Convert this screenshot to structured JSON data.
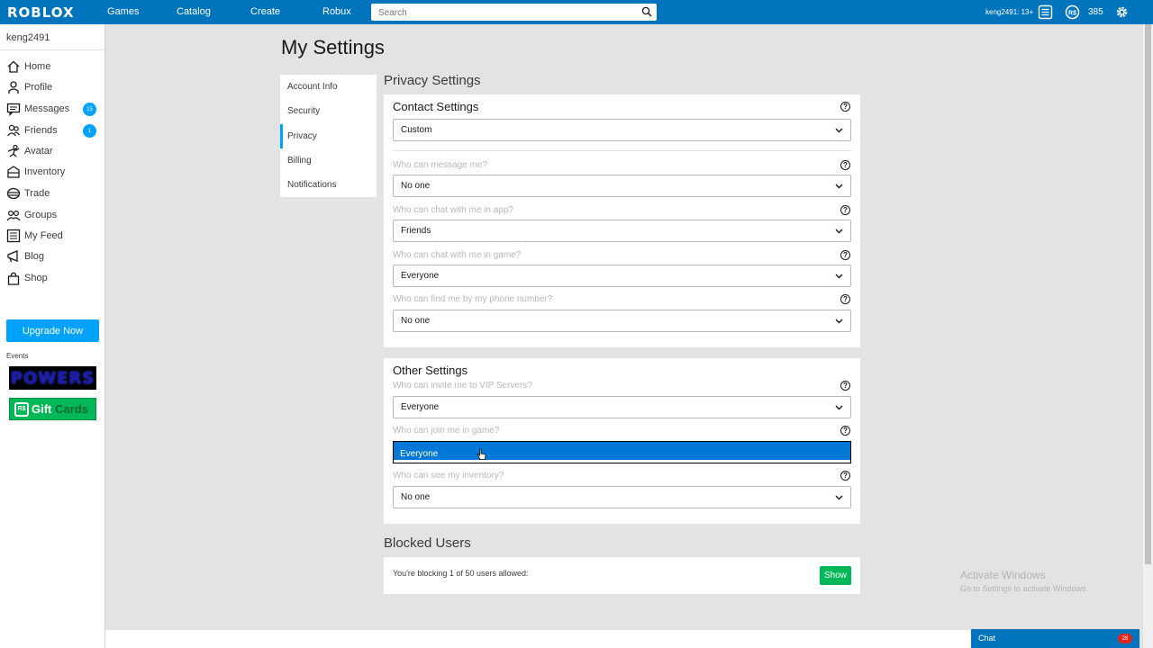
{
  "topbar": {
    "logo": "ROBLOX",
    "nav": [
      "Games",
      "Catalog",
      "Create",
      "Robux"
    ],
    "search_placeholder": "Search",
    "user_age": "keng2491: 13+",
    "robux": "385",
    "icons": [
      "messages-list-icon",
      "robux-icon",
      "settings-gear-icon"
    ],
    "color": "#0074bd"
  },
  "sidebar": {
    "username": "keng2491",
    "items": [
      {
        "label": "Home",
        "icon": "home-icon"
      },
      {
        "label": "Profile",
        "icon": "profile-icon"
      },
      {
        "label": "Messages",
        "icon": "messages-icon",
        "badge": "15"
      },
      {
        "label": "Friends",
        "icon": "friends-icon",
        "badge": "1"
      },
      {
        "label": "Avatar",
        "icon": "avatar-icon"
      },
      {
        "label": "Inventory",
        "icon": "inventory-icon"
      },
      {
        "label": "Trade",
        "icon": "trade-icon"
      },
      {
        "label": "Groups",
        "icon": "groups-icon"
      },
      {
        "label": "My Feed",
        "icon": "feed-icon"
      },
      {
        "label": "Blog",
        "icon": "blog-icon"
      },
      {
        "label": "Shop",
        "icon": "shop-icon"
      }
    ],
    "upgrade": "Upgrade Now",
    "events_label": "Events",
    "event_powers": "POWERS",
    "event_gift_rs": "R$",
    "event_gift": "Gift",
    "event_cards": "Cards"
  },
  "page": {
    "title": "My Settings",
    "tabs": [
      "Account Info",
      "Security",
      "Privacy",
      "Billing",
      "Notifications"
    ],
    "active_tab": "Privacy"
  },
  "privacy": {
    "section_title": "Privacy Settings",
    "contact": {
      "title": "Contact Settings",
      "value": "Custom",
      "questions": [
        {
          "label": "Who can message me?",
          "value": "No one"
        },
        {
          "label": "Who can chat with me in app?",
          "value": "Friends"
        },
        {
          "label": "Who can chat with me in game?",
          "value": "Everyone"
        },
        {
          "label": "Who can find me by my phone number?",
          "value": "No one"
        }
      ]
    },
    "other": {
      "title": "Other Settings",
      "vip": {
        "label": "Who can invite me to VIP Servers?",
        "value": "Everyone"
      },
      "join": {
        "label": "Who can join me in game?",
        "open_option": "Everyone"
      },
      "inventory": {
        "label": "Who can see my inventory?",
        "value": "No one"
      }
    }
  },
  "blocked": {
    "title": "Blocked Users",
    "text": "You're blocking 1 of 50 users allowed:",
    "button": "Show"
  },
  "watermark": {
    "line1": "Activate Windows",
    "line2": "Go to Settings to activate Windows."
  },
  "chat": {
    "label": "Chat",
    "badge": "28"
  },
  "help_glyph": "?"
}
